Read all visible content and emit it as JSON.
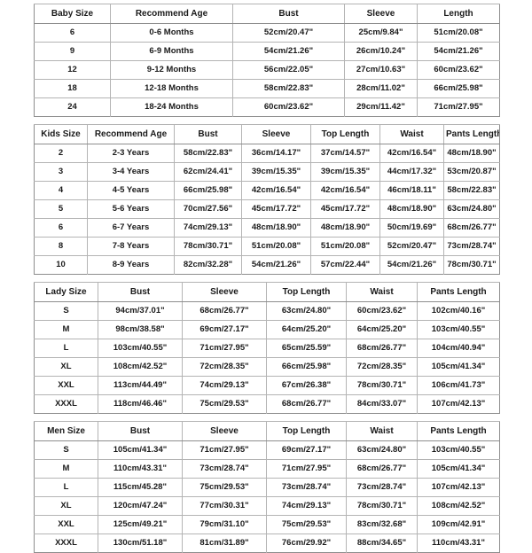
{
  "tables": [
    {
      "id": "baby-size-table",
      "name": "Baby Size",
      "columns": [
        "Baby Size",
        "Recommend Age",
        "Bust",
        "Sleeve",
        "Length"
      ],
      "rows": [
        [
          "6",
          "0-6 Months",
          "52cm/20.47\"",
          "25cm/9.84\"",
          "51cm/20.08\""
        ],
        [
          "9",
          "6-9 Months",
          "54cm/21.26\"",
          "26cm/10.24\"",
          "54cm/21.26\""
        ],
        [
          "12",
          "9-12 Months",
          "56cm/22.05\"",
          "27cm/10.63\"",
          "60cm/23.62\""
        ],
        [
          "18",
          "12-18 Months",
          "58cm/22.83\"",
          "28cm/11.02\"",
          "66cm/25.98\""
        ],
        [
          "24",
          "18-24 Months",
          "60cm/23.62\"",
          "29cm/11.42\"",
          "71cm/27.95\""
        ]
      ]
    },
    {
      "id": "kids-size-table",
      "name": "Kids Size",
      "columns": [
        "Kids Size",
        "Recommend Age",
        "Bust",
        "Sleeve",
        "Top Length",
        "Waist",
        "Pants Length"
      ],
      "rows": [
        [
          "2",
          "2-3 Years",
          "58cm/22.83\"",
          "36cm/14.17\"",
          "37cm/14.57\"",
          "42cm/16.54\"",
          "48cm/18.90\""
        ],
        [
          "3",
          "3-4 Years",
          "62cm/24.41\"",
          "39cm/15.35\"",
          "39cm/15.35\"",
          "44cm/17.32\"",
          "53cm/20.87\""
        ],
        [
          "4",
          "4-5 Years",
          "66cm/25.98\"",
          "42cm/16.54\"",
          "42cm/16.54\"",
          "46cm/18.11\"",
          "58cm/22.83\""
        ],
        [
          "5",
          "5-6 Years",
          "70cm/27.56\"",
          "45cm/17.72\"",
          "45cm/17.72\"",
          "48cm/18.90\"",
          "63cm/24.80\""
        ],
        [
          "6",
          "6-7 Years",
          "74cm/29.13\"",
          "48cm/18.90\"",
          "48cm/18.90\"",
          "50cm/19.69\"",
          "68cm/26.77\""
        ],
        [
          "8",
          "7-8 Years",
          "78cm/30.71\"",
          "51cm/20.08\"",
          "51cm/20.08\"",
          "52cm/20.47\"",
          "73cm/28.74\""
        ],
        [
          "10",
          "8-9 Years",
          "82cm/32.28\"",
          "54cm/21.26\"",
          "57cm/22.44\"",
          "54cm/21.26\"",
          "78cm/30.71\""
        ]
      ]
    },
    {
      "id": "lady-size-table",
      "name": "Lady Size",
      "columns": [
        "Lady Size",
        "Bust",
        "Sleeve",
        "Top Length",
        "Waist",
        "Pants Length"
      ],
      "rows": [
        [
          "S",
          "94cm/37.01\"",
          "68cm/26.77\"",
          "63cm/24.80\"",
          "60cm/23.62\"",
          "102cm/40.16\""
        ],
        [
          "M",
          "98cm/38.58\"",
          "69cm/27.17\"",
          "64cm/25.20\"",
          "64cm/25.20\"",
          "103cm/40.55\""
        ],
        [
          "L",
          "103cm/40.55\"",
          "71cm/27.95\"",
          "65cm/25.59\"",
          "68cm/26.77\"",
          "104cm/40.94\""
        ],
        [
          "XL",
          "108cm/42.52\"",
          "72cm/28.35\"",
          "66cm/25.98\"",
          "72cm/28.35\"",
          "105cm/41.34\""
        ],
        [
          "XXL",
          "113cm/44.49\"",
          "74cm/29.13\"",
          "67cm/26.38\"",
          "78cm/30.71\"",
          "106cm/41.73\""
        ],
        [
          "XXXL",
          "118cm/46.46\"",
          "75cm/29.53\"",
          "68cm/26.77\"",
          "84cm/33.07\"",
          "107cm/42.13\""
        ]
      ]
    },
    {
      "id": "men-size-table",
      "name": "Men Size",
      "columns": [
        "Men Size",
        "Bust",
        "Sleeve",
        "Top Length",
        "Waist",
        "Pants Length"
      ],
      "rows": [
        [
          "S",
          "105cm/41.34\"",
          "71cm/27.95\"",
          "69cm/27.17\"",
          "63cm/24.80\"",
          "103cm/40.55\""
        ],
        [
          "M",
          "110cm/43.31\"",
          "73cm/28.74\"",
          "71cm/27.95\"",
          "68cm/26.77\"",
          "105cm/41.34\""
        ],
        [
          "L",
          "115cm/45.28\"",
          "75cm/29.53\"",
          "73cm/28.74\"",
          "73cm/28.74\"",
          "107cm/42.13\""
        ],
        [
          "XL",
          "120cm/47.24\"",
          "77cm/30.31\"",
          "74cm/29.13\"",
          "78cm/30.71\"",
          "108cm/42.52\""
        ],
        [
          "XXL",
          "125cm/49.21\"",
          "79cm/31.10\"",
          "75cm/29.53\"",
          "83cm/32.68\"",
          "109cm/42.91\""
        ],
        [
          "XXXL",
          "130cm/51.18\"",
          "81cm/31.89\"",
          "76cm/29.92\"",
          "88cm/34.65\"",
          "110cm/43.31\""
        ]
      ]
    }
  ],
  "colors": {
    "background": "#ffffff",
    "text": "#1a1a1a",
    "border_outer": "#8d8d8d",
    "border_inner": "#b4b4b4"
  }
}
